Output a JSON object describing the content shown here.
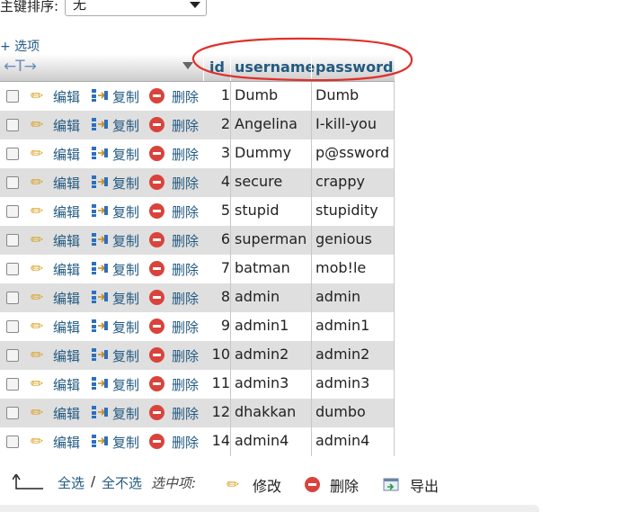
{
  "sort": {
    "label": "主键排序:",
    "selected": "无"
  },
  "options_link": "+ 选项",
  "header": {
    "arrows": "←T→",
    "columns": [
      "id",
      "username",
      "password"
    ]
  },
  "actions": {
    "edit": "编辑",
    "copy": "复制",
    "delete": "删除"
  },
  "rows": [
    {
      "id": "1",
      "username": "Dumb",
      "password": "Dumb"
    },
    {
      "id": "2",
      "username": "Angelina",
      "password": "I-kill-you"
    },
    {
      "id": "3",
      "username": "Dummy",
      "password": "p@ssword"
    },
    {
      "id": "4",
      "username": "secure",
      "password": "crappy"
    },
    {
      "id": "5",
      "username": "stupid",
      "password": "stupidity"
    },
    {
      "id": "6",
      "username": "superman",
      "password": "genious"
    },
    {
      "id": "7",
      "username": "batman",
      "password": "mob!le"
    },
    {
      "id": "8",
      "username": "admin",
      "password": "admin"
    },
    {
      "id": "9",
      "username": "admin1",
      "password": "admin1"
    },
    {
      "id": "10",
      "username": "admin2",
      "password": "admin2"
    },
    {
      "id": "11",
      "username": "admin3",
      "password": "admin3"
    },
    {
      "id": "12",
      "username": "dhakkan",
      "password": "dumbo"
    },
    {
      "id": "14",
      "username": "admin4",
      "password": "admin4"
    }
  ],
  "bottom": {
    "check_all": "全选",
    "separator": "/",
    "uncheck_all": "全不选",
    "with_selected": "选中项:",
    "edit": "修改",
    "delete": "删除",
    "export": "导出"
  },
  "colors": {
    "link": "#235a81",
    "annotation": "#e0302a",
    "row_even": "#dfdfdf"
  }
}
